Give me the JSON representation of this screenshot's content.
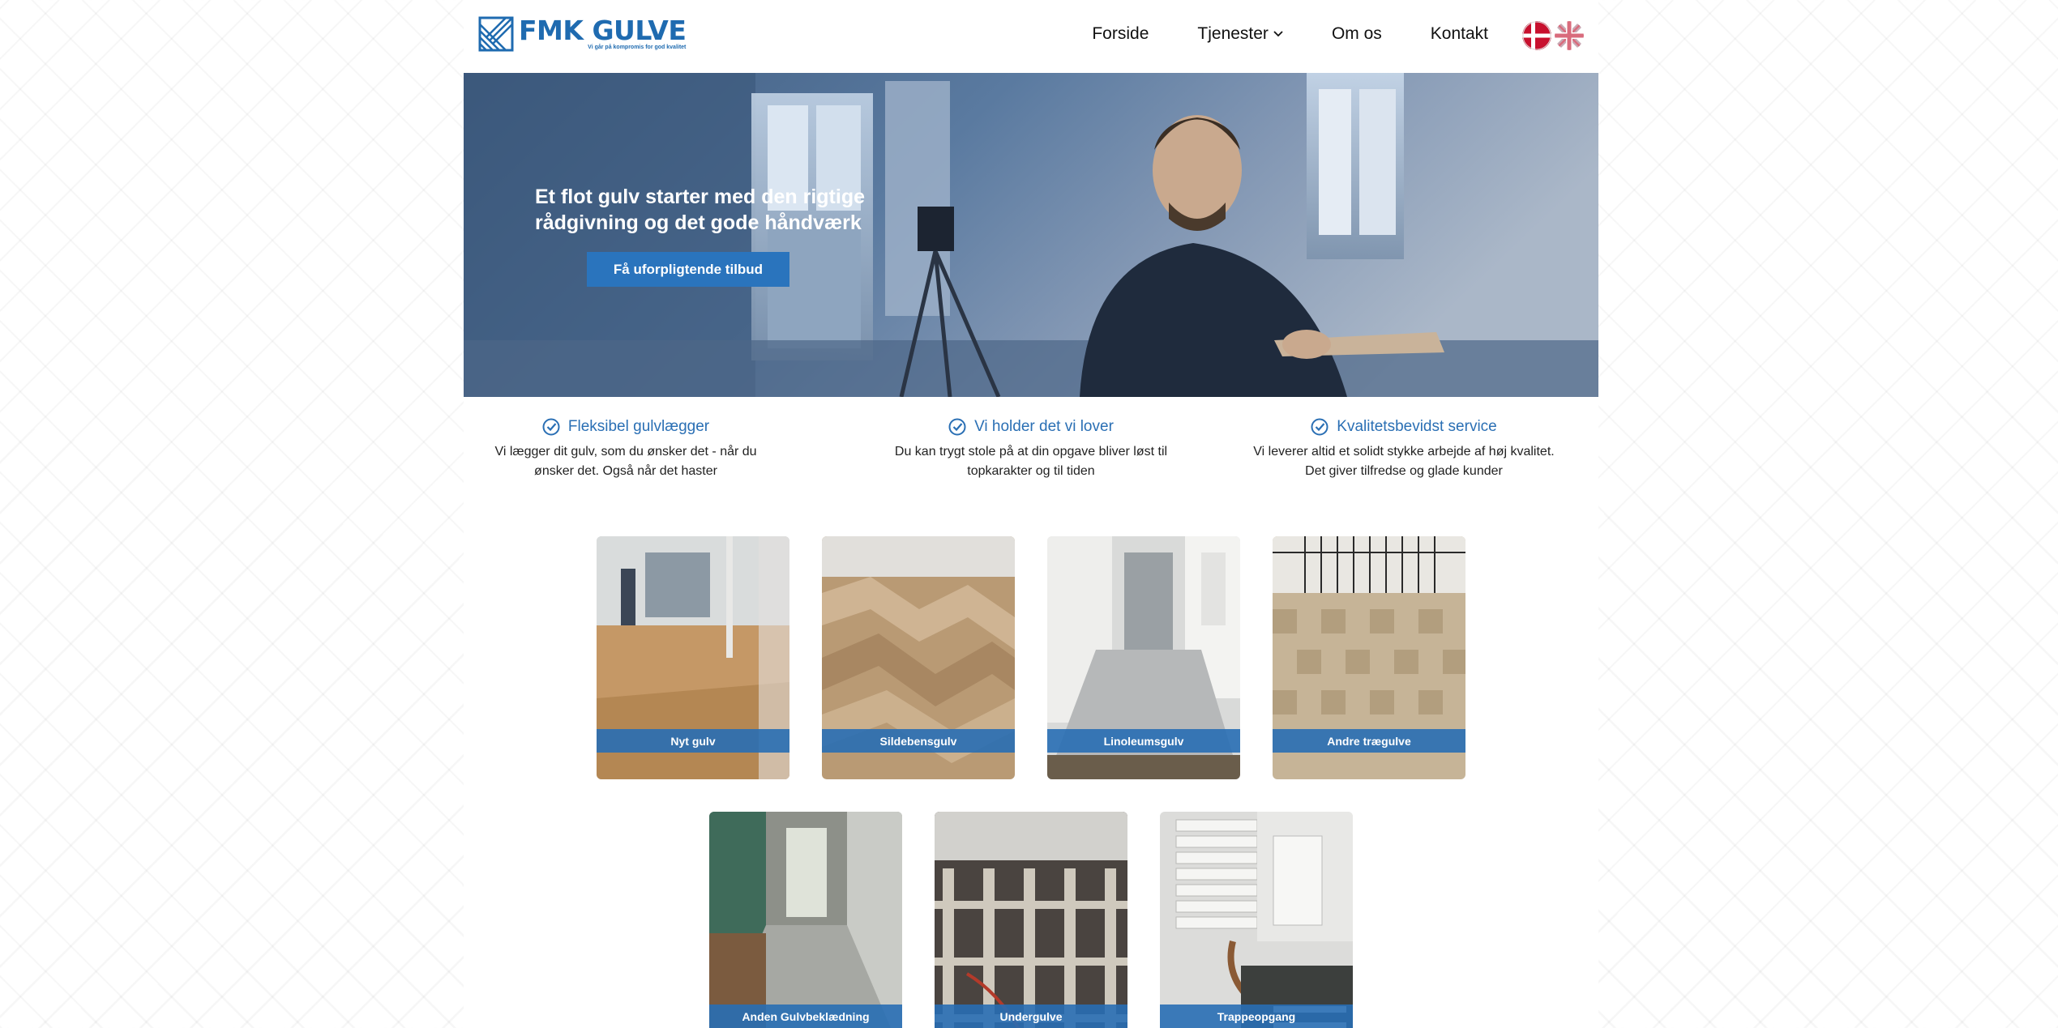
{
  "brand": {
    "name": "FMK GULVE",
    "tagline": "Vi går på kompromis for god kvalitet",
    "color": "#1f6bb0"
  },
  "nav": {
    "items": [
      {
        "label": "Forside"
      },
      {
        "label": "Tjenester"
      },
      {
        "label": "Om os"
      },
      {
        "label": "Kontakt"
      }
    ],
    "languages": [
      "danish-flag",
      "uk-flag"
    ]
  },
  "hero": {
    "title": "Et flot gulv starter med den rigtige rådgivning og det gode håndværk",
    "cta_label": "Få uforpligtende tilbud"
  },
  "features": [
    {
      "title": "Fleksibel gulvlægger",
      "text": "Vi lægger dit gulv, som du ønsker det - når du ønsker det. Også når det haster"
    },
    {
      "title": "Vi holder det vi lover",
      "text": "Du kan trygt stole på at din opgave bliver løst til topkarakter og til tiden"
    },
    {
      "title": "Kvalitetsbevidst service",
      "text": "Vi leverer altid et solidt stykke arbejde af høj kvalitet. Det giver tilfredse og glade kunder"
    }
  ],
  "services": [
    {
      "label": "Nyt gulv"
    },
    {
      "label": "Sildebensgulv"
    },
    {
      "label": "Linoleumsgulv"
    },
    {
      "label": "Andre trægulve"
    },
    {
      "label": "Anden Gulvbeklædning"
    },
    {
      "label": "Undergulve"
    },
    {
      "label": "Trappeopgang"
    }
  ],
  "colors": {
    "accent": "#2a74bd",
    "label_bg": "#286eb4"
  }
}
